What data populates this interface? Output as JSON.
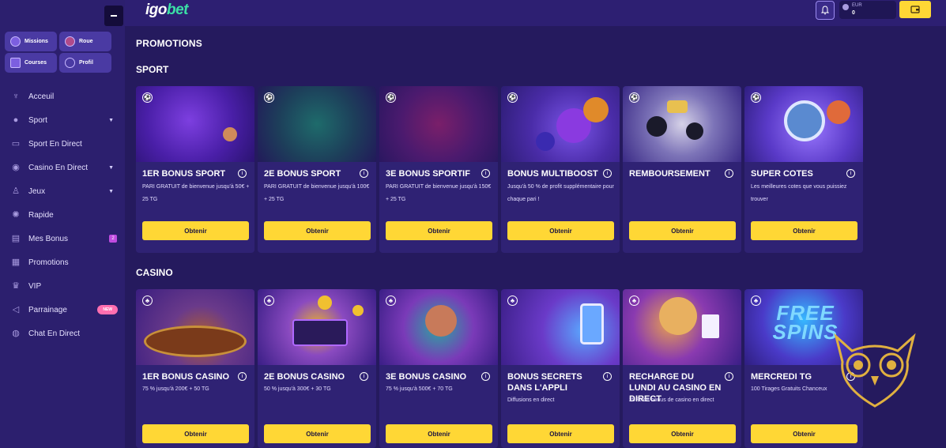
{
  "brand": {
    "logo_main": "igo",
    "logo_accent": "bet"
  },
  "topbar": {
    "currency": "EUR",
    "balance": "0"
  },
  "sidebar": {
    "quick": [
      {
        "label": "Missions",
        "icon": "target-icon"
      },
      {
        "label": "Roue",
        "icon": "wheel-icon"
      },
      {
        "label": "Courses",
        "icon": "trophy-icon"
      },
      {
        "label": "Profil",
        "icon": "search-icon"
      }
    ],
    "items": [
      {
        "label": "Acceuil",
        "icon": "cup-icon"
      },
      {
        "label": "Sport",
        "icon": "football-icon",
        "expand": "▼"
      },
      {
        "label": "Sport En Direct",
        "icon": "live-icon"
      },
      {
        "label": "Casino En Direct",
        "icon": "chip-icon",
        "expand": "▼"
      },
      {
        "label": "Jeux",
        "icon": "bag-icon",
        "expand": "▼"
      },
      {
        "label": "Rapide",
        "icon": "bolt-icon"
      },
      {
        "label": "Mes Bonus",
        "icon": "gift-icon",
        "count": "2"
      },
      {
        "label": "Promotions",
        "icon": "present-icon"
      },
      {
        "label": "VIP",
        "icon": "crown-icon"
      },
      {
        "label": "Parrainage",
        "icon": "megaphone-icon",
        "badge": "NEW"
      },
      {
        "label": "Chat En Direct",
        "icon": "chat-icon"
      }
    ]
  },
  "page": {
    "title": "PROMOTIONS"
  },
  "sections": {
    "sport": {
      "title": "SPORT",
      "cards": [
        {
          "title": "1ER BONUS SPORT",
          "desc": "PARI GRATUIT de bienvenue jusqu'à 50€ + 25 TG",
          "cta": "Obtenir"
        },
        {
          "title": "2E BONUS SPORT",
          "desc": "PARI GRATUIT de bienvenue jusqu'à 100€ + 25 TG",
          "cta": "Obtenir"
        },
        {
          "title": "3E BONUS SPORTIF",
          "desc": "PARI GRATUIT de bienvenue jusqu'à 150€ + 25 TG",
          "cta": "Obtenir"
        },
        {
          "title": "BONUS MULTIBOOST",
          "desc": "Jusqu'à 50 % de profit supplémentaire pour chaque pari !",
          "cta": "Obtenir"
        },
        {
          "title": "REMBOURSEMENT",
          "desc": "",
          "cta": "Obtenir"
        },
        {
          "title": "SUPER COTES",
          "desc": "Les meilleures cotes que vous puissiez trouver",
          "cta": "Obtenir"
        }
      ]
    },
    "casino": {
      "title": "CASINO",
      "cards": [
        {
          "title": "1ER BONUS CASINO",
          "desc": "75 % jusqu'à 200€ + 50 TG",
          "cta": "Obtenir"
        },
        {
          "title": "2E BONUS CASINO",
          "desc": "50 % jusqu'à 300€ + 30 TG",
          "cta": "Obtenir"
        },
        {
          "title": "3E BONUS CASINO",
          "desc": "75 % jusqu'à 500€ + 70 TG",
          "cta": "Obtenir"
        },
        {
          "title": "BONUS SECRETS DANS L'APPLI",
          "desc": "Diffusions en direct",
          "cta": "Obtenir"
        },
        {
          "title": "RECHARGE DU LUNDI AU CASINO EN DIRECT",
          "desc": "25 % de bonus de casino en direct",
          "cta": "Obtenir"
        },
        {
          "title": "MERCREDI TG",
          "desc": "100 Tirages Gratuits Chanceux",
          "cta": "Obtenir",
          "art_text": "FREE SPINS"
        }
      ]
    }
  },
  "colors": {
    "accent_yellow": "#ffd735",
    "brand_green": "#3be0a6",
    "sidebar": "#2c1f6e",
    "main": "#251a5e"
  }
}
